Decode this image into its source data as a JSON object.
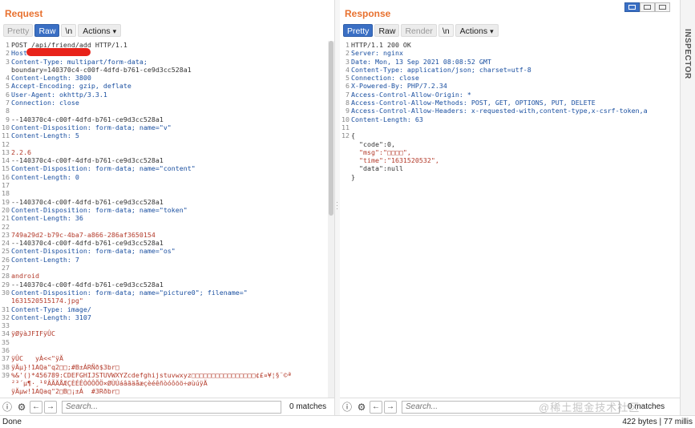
{
  "request": {
    "title": "Request",
    "toolbar": {
      "pretty": "Pretty",
      "raw": "Raw",
      "nl": "\\n",
      "actions": "Actions"
    },
    "lines": [
      {
        "n": "1",
        "t": "POST /api/friend/add HTTP/1.1",
        "c": "c-val"
      },
      {
        "n": "2",
        "t": "Host:",
        "c": "c-key"
      },
      {
        "n": "3",
        "t": "Content-Type: multipart/form-data;",
        "c": "c-key"
      },
      {
        "n": "",
        "t": "boundary=140370c4-c00f-4dfd-b761-ce9d3cc528a1",
        "c": "c-val"
      },
      {
        "n": "4",
        "t": "Content-Length: 3800",
        "c": "c-key"
      },
      {
        "n": "5",
        "t": "Accept-Encoding: gzip, deflate",
        "c": "c-key"
      },
      {
        "n": "6",
        "t": "User-Agent: okhttp/3.3.1",
        "c": "c-key"
      },
      {
        "n": "7",
        "t": "Connection: close",
        "c": "c-key"
      },
      {
        "n": "8",
        "t": "",
        "c": "c-val"
      },
      {
        "n": "9",
        "t": "--140370c4-c00f-4dfd-b761-ce9d3cc528a1",
        "c": "c-val"
      },
      {
        "n": "10",
        "t": "Content-Disposition: form-data; name=\"v\"",
        "c": "c-key"
      },
      {
        "n": "11",
        "t": "Content-Length: 5",
        "c": "c-key"
      },
      {
        "n": "12",
        "t": "",
        "c": "c-val"
      },
      {
        "n": "13",
        "t": "2.2.6",
        "c": "c-red"
      },
      {
        "n": "14",
        "t": "--140370c4-c00f-4dfd-b761-ce9d3cc528a1",
        "c": "c-val"
      },
      {
        "n": "15",
        "t": "Content-Disposition: form-data; name=\"content\"",
        "c": "c-key"
      },
      {
        "n": "16",
        "t": "Content-Length: 0",
        "c": "c-key"
      },
      {
        "n": "17",
        "t": "",
        "c": "c-val"
      },
      {
        "n": "18",
        "t": "",
        "c": "c-val"
      },
      {
        "n": "19",
        "t": "--140370c4-c00f-4dfd-b761-ce9d3cc528a1",
        "c": "c-val"
      },
      {
        "n": "20",
        "t": "Content-Disposition: form-data; name=\"token\"",
        "c": "c-key"
      },
      {
        "n": "21",
        "t": "Content-Length: 36",
        "c": "c-key"
      },
      {
        "n": "22",
        "t": "",
        "c": "c-val"
      },
      {
        "n": "23",
        "t": "749a29d2-b79c-4ba7-a866-286af3650154",
        "c": "c-red"
      },
      {
        "n": "24",
        "t": "--140370c4-c00f-4dfd-b761-ce9d3cc528a1",
        "c": "c-val"
      },
      {
        "n": "25",
        "t": "Content-Disposition: form-data; name=\"os\"",
        "c": "c-key"
      },
      {
        "n": "26",
        "t": "Content-Length: 7",
        "c": "c-key"
      },
      {
        "n": "27",
        "t": "",
        "c": "c-val"
      },
      {
        "n": "28",
        "t": "android",
        "c": "c-red"
      },
      {
        "n": "29",
        "t": "--140370c4-c00f-4dfd-b761-ce9d3cc528a1",
        "c": "c-val"
      },
      {
        "n": "30",
        "t": "Content-Disposition: form-data; name=\"picture0\"; filename=\"",
        "c": "c-key"
      },
      {
        "n": "",
        "t": "1631520515174.jpg\"",
        "c": "c-red"
      },
      {
        "n": "31",
        "t": "Content-Type: image/",
        "c": "c-key"
      },
      {
        "n": "32",
        "t": "Content-Length: 3107",
        "c": "c-key"
      },
      {
        "n": "33",
        "t": "",
        "c": "c-val"
      },
      {
        "n": "34",
        "t": "ÿØÿàJFIFÿÛC",
        "c": "c-bin"
      },
      {
        "n": "35",
        "t": "",
        "c": "c-val"
      },
      {
        "n": "36",
        "t": "",
        "c": "c-val"
      },
      {
        "n": "37",
        "t": "ÿÛC   yÀ<<\"ÿÄ",
        "c": "c-bin"
      },
      {
        "n": "38",
        "t": "ÿÄµ}!1AQa\"q2□□;#B±ÁRÑð$3br□",
        "c": "c-bin"
      },
      {
        "n": "39",
        "t": "%&'()*456789:CDEFGHIJSTUVWXYZcdefghijstuvwxyz□□□□□□□□□□□□□□□□¢£¤¥¦§¨©ª",
        "c": "c-bin"
      },
      {
        "n": "",
        "t": "²³´µ¶·¸¹ºÂÃÄÅÆÇÈÉÊÒÓÔÕÖ×ØÙÚáâãäåæçèéêñòóôõö÷øùúÿÄ",
        "c": "c-bin"
      },
      {
        "n": "",
        "t": "ÿÄµw!1AQaq\"2□B□¡±Á  #3Rðbr□",
        "c": "c-bin"
      },
      {
        "n": "40",
        "t": "",
        "c": "c-bin"
      }
    ],
    "search": {
      "placeholder": "Search...",
      "matches": "0 matches"
    }
  },
  "response": {
    "title": "Response",
    "toolbar": {
      "pretty": "Pretty",
      "raw": "Raw",
      "render": "Render",
      "nl": "\\n",
      "actions": "Actions"
    },
    "lines": [
      {
        "n": "1",
        "t": "HTTP/1.1 200 OK",
        "c": "c-val"
      },
      {
        "n": "2",
        "t": "Server: nginx",
        "c": "c-key"
      },
      {
        "n": "3",
        "t": "Date: Mon, 13 Sep 2021 08:08:52 GMT",
        "c": "c-key"
      },
      {
        "n": "4",
        "t": "Content-Type: application/json; charset=utf-8",
        "c": "c-key"
      },
      {
        "n": "5",
        "t": "Connection: close",
        "c": "c-key"
      },
      {
        "n": "6",
        "t": "X-Powered-By: PHP/7.2.34",
        "c": "c-key"
      },
      {
        "n": "7",
        "t": "Access-Control-Allow-Origin: *",
        "c": "c-key"
      },
      {
        "n": "8",
        "t": "Access-Control-Allow-Methods: POST, GET, OPTIONS, PUT, DELETE",
        "c": "c-key"
      },
      {
        "n": "9",
        "t": "Access-Control-Allow-Headers: x-requested-with,content-type,x-csrf-token,a",
        "c": "c-key"
      },
      {
        "n": "10",
        "t": "Content-Length: 63",
        "c": "c-key"
      },
      {
        "n": "11",
        "t": "",
        "c": "c-val"
      },
      {
        "n": "12",
        "t": "{",
        "c": "c-val"
      },
      {
        "n": "",
        "t": "  \"code\":0,",
        "c": "c-val"
      },
      {
        "n": "",
        "t": "  \"msg\":\"□□□□\",",
        "c": "c-str"
      },
      {
        "n": "",
        "t": "  \"time\":\"1631520532\",",
        "c": "c-str"
      },
      {
        "n": "",
        "t": "  \"data\":null",
        "c": "c-val"
      },
      {
        "n": "",
        "t": "}",
        "c": "c-val"
      }
    ],
    "search": {
      "placeholder": "Search...",
      "matches": "0 matches"
    }
  },
  "inspector": {
    "label": "INSPECTOR"
  },
  "status": {
    "left": "Done",
    "right": "422 bytes | 77 millis"
  },
  "watermark": "@稀土掘金技术社区"
}
